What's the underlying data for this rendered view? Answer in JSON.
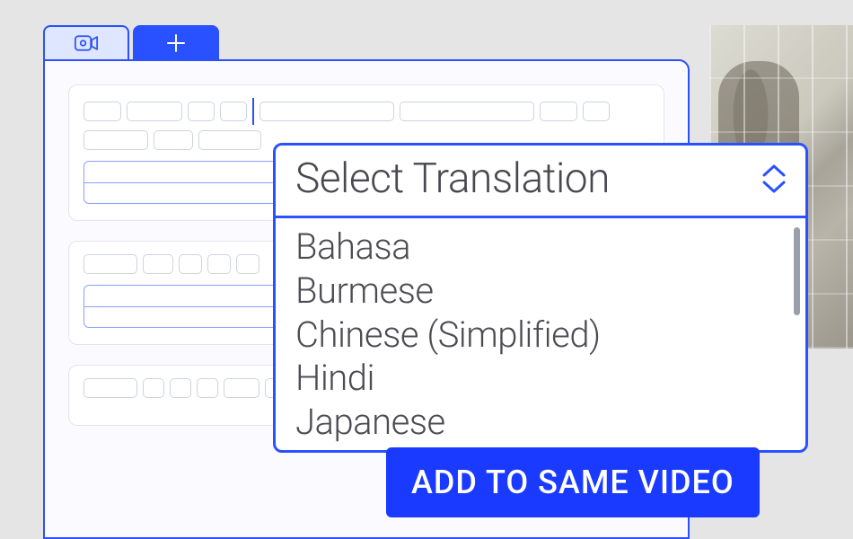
{
  "tabs": {
    "video_icon": "camera",
    "add_icon": "plus"
  },
  "dropdown": {
    "label": "Select Translation",
    "options": [
      "Bahasa",
      "Burmese",
      "Chinese (Simplified)",
      "Hindi",
      "Japanese"
    ]
  },
  "cta": {
    "label": "ADD TO SAME VIDEO"
  },
  "colors": {
    "accent": "#2a51ff",
    "cta_bg": "#1a3bff"
  }
}
